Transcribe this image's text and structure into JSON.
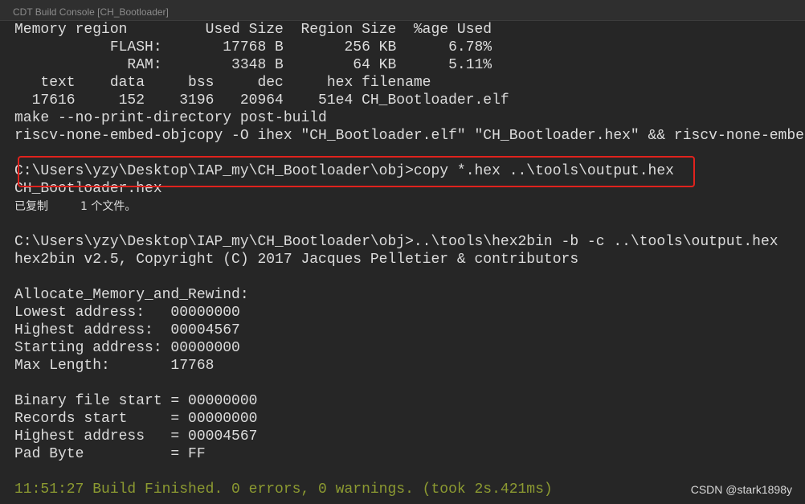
{
  "window": {
    "title": "CDT Build Console [CH_Bootloader]"
  },
  "console": {
    "lines": [
      "Memory region         Used Size  Region Size  %age Used",
      "           FLASH:       17768 B       256 KB      6.78%",
      "             RAM:        3348 B        64 KB      5.11%",
      "   text    data     bss     dec     hex filename",
      "  17616     152    3196   20964    51e4 CH_Bootloader.elf",
      "make --no-print-directory post-build",
      "riscv-none-embed-objcopy -O ihex \"CH_Bootloader.elf\" \"CH_Bootloader.hex\" && riscv-none-embed-objcopy -O binary \"CH_Bootloader.elf\" \"CH_Bootloader.bin\"",
      "",
      "C:\\Users\\yzy\\Desktop\\IAP_my\\CH_Bootloader\\obj>copy *.hex ..\\tools\\output.hex",
      "CH_Bootloader.hex",
      "已复制         1 个文件。",
      "",
      "C:\\Users\\yzy\\Desktop\\IAP_my\\CH_Bootloader\\obj>..\\tools\\hex2bin -b -c ..\\tools\\output.hex",
      "hex2bin v2.5, Copyright (C) 2017 Jacques Pelletier & contributors",
      "",
      "Allocate_Memory_and_Rewind:",
      "Lowest address:   00000000",
      "Highest address:  00004567",
      "Starting address: 00000000",
      "Max Length:       17768",
      "",
      "Binary file start = 00000000",
      "Records start     = 00000000",
      "Highest address   = 00004567",
      "Pad Byte          = FF",
      "",
      "11:51:27 Build Finished. 0 errors, 0 warnings. (took 2s.421ms)"
    ]
  },
  "watermark": "CSDN @stark1898y",
  "colors": {
    "background": "#262626",
    "text": "#dcdcdc",
    "build_status": "#8c9a31",
    "highlight_box": "#e0221d"
  }
}
